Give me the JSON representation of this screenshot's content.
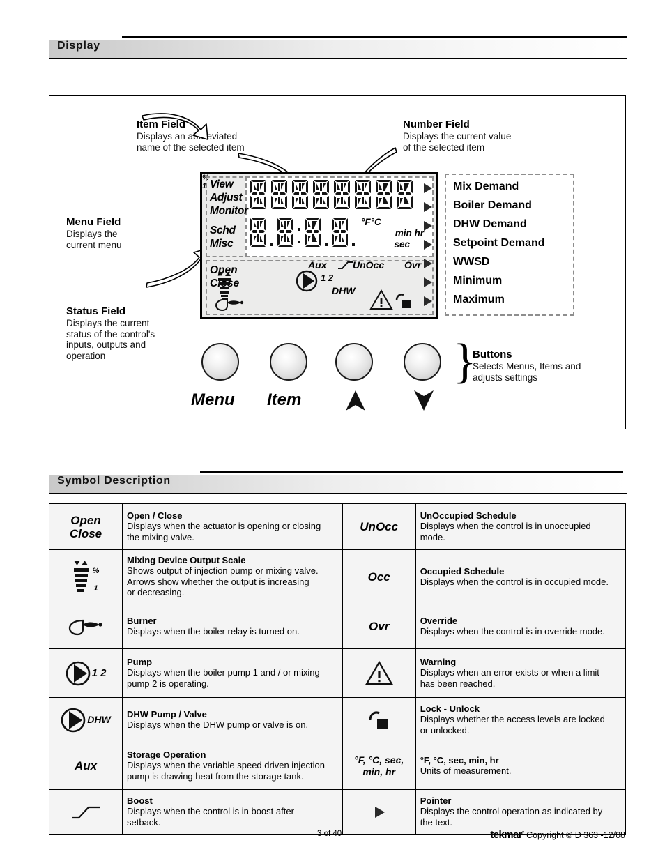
{
  "sections": {
    "display": {
      "title": "Display"
    },
    "symbols": {
      "title": "Symbol Description"
    }
  },
  "callouts": {
    "item_field": {
      "title": "Item Field",
      "desc": "Displays an abbreviated\nname of the selected item"
    },
    "number_field": {
      "title": "Number Field",
      "desc": "Displays the current value\nof the selected item"
    },
    "menu_field": {
      "title": "Menu Field",
      "desc": "Displays the\ncurrent menu"
    },
    "status_field": {
      "title": "Status Field",
      "desc": "Displays the current\nstatus of the control's\ninputs, outputs and\noperation"
    },
    "buttons": {
      "title": "Buttons",
      "desc": "Selects Menus, Items and\nadjusts settings"
    }
  },
  "lcd": {
    "menu_words": [
      "View",
      "Adjust",
      "Monitor"
    ],
    "menu_words_2": [
      "Schd",
      "Misc"
    ],
    "openclose": [
      "Open",
      "Close"
    ],
    "item_chars": 8,
    "number_chars": 4,
    "units": {
      "degF": "°F",
      "degC": "°C",
      "min": "min",
      "hr": "hr",
      "sec": "sec"
    },
    "status": {
      "aux": "Aux",
      "unocc": "UnOcc",
      "ovr": "Ovr",
      "pump_nums": "1 2",
      "dhw": "DHW",
      "percent": "%",
      "one": "1"
    },
    "pointer_count": 7
  },
  "right_labels": [
    "Mix Demand",
    "Boiler Demand",
    "DHW Demand",
    "Setpoint Demand",
    "WWSD",
    "Minimum",
    "Maximum"
  ],
  "buttons": [
    {
      "label": "Menu",
      "type": "text"
    },
    {
      "label": "Item",
      "type": "text"
    },
    {
      "label": "",
      "type": "up-arrow"
    },
    {
      "label": "",
      "type": "down-arrow"
    }
  ],
  "symbol_table": {
    "left": [
      {
        "symbol": "Open\nClose",
        "symbol_type": "text",
        "title": "Open / Close",
        "desc": "Displays when the actuator is opening or closing\nthe mixing valve."
      },
      {
        "symbol": "",
        "symbol_type": "mixing-scale-icon",
        "title": "Mixing Device Output Scale",
        "desc": "Shows output of injection pump or mixing valve.\nArrows show whether the output is increasing\nor decreasing."
      },
      {
        "symbol": "",
        "symbol_type": "burner-icon",
        "title": "Burner",
        "desc": "Displays when the boiler relay is turned on."
      },
      {
        "symbol": "1 2",
        "symbol_type": "pump-icon",
        "title": "Pump",
        "desc": "Displays when the boiler pump 1 and / or mixing\npump 2 is operating."
      },
      {
        "symbol": "DHW",
        "symbol_type": "pump-icon",
        "title": "DHW Pump / Valve",
        "desc": "Displays when the DHW pump or valve is on."
      },
      {
        "symbol": "Aux",
        "symbol_type": "text",
        "title": "Storage Operation",
        "desc": "Displays when the variable speed driven injection\npump is drawing heat from the storage tank."
      },
      {
        "symbol": "",
        "symbol_type": "boost-icon",
        "title": "Boost",
        "desc": "Displays when the control is in boost after\nsetback."
      }
    ],
    "right": [
      {
        "symbol": "UnOcc",
        "symbol_type": "text",
        "title": "UnOccupied Schedule",
        "desc": "Displays when the control is in unoccupied\nmode."
      },
      {
        "symbol": "Occ",
        "symbol_type": "text",
        "title": "Occupied Schedule",
        "desc": "Displays when the control is in occupied mode."
      },
      {
        "symbol": "Ovr",
        "symbol_type": "text",
        "title": "Override",
        "desc": "Displays when the control is in override mode."
      },
      {
        "symbol": "",
        "symbol_type": "warning-icon",
        "title": "Warning",
        "desc": "Displays when an error exists or when a limit\nhas been reached."
      },
      {
        "symbol": "",
        "symbol_type": "lock-unlock-icon",
        "title": "Lock - Unlock",
        "desc": "Displays whether the access levels are locked\nor unlocked."
      },
      {
        "symbol": "°F, °C, sec,\nmin, hr",
        "symbol_type": "text-small",
        "title": "°F, °C, sec, min, hr",
        "desc": "Units of measurement."
      },
      {
        "symbol": "",
        "symbol_type": "pointer-icon",
        "title": "Pointer",
        "desc": "Displays the control operation as indicated by\nthe text."
      }
    ]
  },
  "footer": {
    "page": "3 of 40",
    "brand": "tekmar",
    "brand_mark": "•",
    "copyright": "Copyright © D 363 -12/08"
  }
}
